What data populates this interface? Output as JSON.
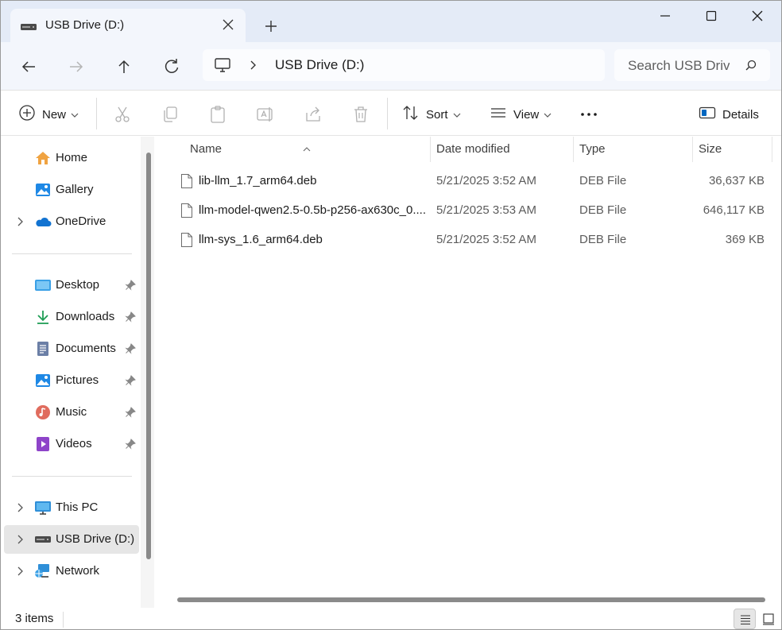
{
  "tab": {
    "title": "USB Drive (D:)",
    "icon": "usb-drive-icon"
  },
  "window_controls": {
    "minimize": "minimize-icon",
    "maximize": "maximize-icon",
    "close": "close-icon"
  },
  "address": {
    "root_icon": "this-pc-icon",
    "path": "USB Drive (D:)"
  },
  "search": {
    "placeholder": "Search USB Driv"
  },
  "toolbar": {
    "new_label": "New",
    "sort_label": "Sort",
    "view_label": "View",
    "details_label": "Details"
  },
  "sidebar": {
    "items": [
      {
        "label": "Home",
        "icon": "home-icon",
        "expandable": false,
        "pinned": false
      },
      {
        "label": "Gallery",
        "icon": "gallery-icon",
        "expandable": false,
        "pinned": false
      },
      {
        "label": "OneDrive",
        "icon": "onedrive-cloud-icon",
        "expandable": true,
        "pinned": false
      },
      {
        "label": "Desktop",
        "icon": "desktop-folder-icon",
        "expandable": false,
        "pinned": true
      },
      {
        "label": "Downloads",
        "icon": "downloads-icon",
        "expandable": false,
        "pinned": true
      },
      {
        "label": "Documents",
        "icon": "documents-icon",
        "expandable": false,
        "pinned": true
      },
      {
        "label": "Pictures",
        "icon": "pictures-icon",
        "expandable": false,
        "pinned": true
      },
      {
        "label": "Music",
        "icon": "music-icon",
        "expandable": false,
        "pinned": true
      },
      {
        "label": "Videos",
        "icon": "videos-icon",
        "expandable": false,
        "pinned": true
      },
      {
        "label": "This PC",
        "icon": "this-pc-icon",
        "expandable": true,
        "pinned": false
      },
      {
        "label": "USB Drive (D:)",
        "icon": "usb-drive-icon",
        "expandable": true,
        "pinned": false,
        "selected": true
      },
      {
        "label": "Network",
        "icon": "network-icon",
        "expandable": true,
        "pinned": false
      }
    ]
  },
  "file_list": {
    "columns": [
      "Name",
      "Date modified",
      "Type",
      "Size"
    ],
    "sort": {
      "column": "Name",
      "direction": "ascending"
    },
    "rows": [
      {
        "name": "lib-llm_1.7_arm64.deb",
        "date": "5/21/2025 3:52 AM",
        "type": "DEB File",
        "size": "36,637 KB"
      },
      {
        "name": "llm-model-qwen2.5-0.5b-p256-ax630c_0....",
        "date": "5/21/2025 3:53 AM",
        "type": "DEB File",
        "size": "646,117 KB"
      },
      {
        "name": "llm-sys_1.6_arm64.deb",
        "date": "5/21/2025 3:52 AM",
        "type": "DEB File",
        "size": "369 KB"
      }
    ]
  },
  "status": {
    "item_count": "3 items"
  },
  "colors": {
    "titlebar": "#e4ebf7",
    "navbar": "#f3f6fc",
    "selected": "#e6e6e6",
    "accent": "#0067c0"
  }
}
